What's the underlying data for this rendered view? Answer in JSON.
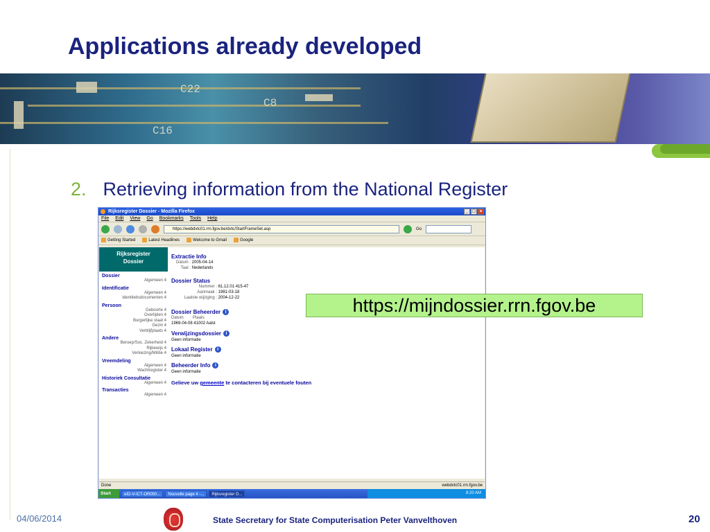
{
  "slide": {
    "title": "Applications already developed",
    "bullet_number": "2.",
    "bullet_text": "Retrieving information from the National Register",
    "url_label": "https://mijndossier.rrn.fgov.be",
    "footer_date": "04/06/2014",
    "footer_text": "State Secretary for State Computerisation Peter Vanvelthoven",
    "page_number": "20",
    "accent_green": "#8dc63f",
    "title_color": "#1a237e"
  },
  "banner": {
    "labels": [
      "C22",
      "C8",
      "C16"
    ]
  },
  "browser": {
    "title": "Rijksregister Dossier - Mozilla Firefox",
    "menu": [
      "File",
      "Edit",
      "View",
      "Go",
      "Bookmarks",
      "Tools",
      "Help"
    ],
    "address": "https://webdvtc01.rrn.fgov.be/dvtc/StartFrameSet.asp",
    "go_label": "Go",
    "bookmarks": [
      "Getting Started",
      "Latest Headlines",
      "Welcome to Gmail",
      "Google"
    ],
    "status": "Done",
    "status_site": "webdvtc01.rrn.fgov.be",
    "taskbar": {
      "start": "Start",
      "tasks": [
        "eID-V-ICT-OR050...",
        "Nouvelle page 4 -...",
        "Rijksregister D..."
      ],
      "clock": "8:20 AM"
    }
  },
  "sidebar": {
    "header_line1": "Rijksregister",
    "header_line2": "Dossier",
    "sections": [
      {
        "title": "Dossier",
        "items": [
          "Algemeen 4"
        ]
      },
      {
        "title": "Identificatie",
        "items": [
          "Algemeen 4",
          "Identiteitsdocumenten 4"
        ]
      },
      {
        "title": "Persoon",
        "items": [
          "Geboorte 4",
          "Overlijden 4",
          "Burgerlijke staat 4",
          "Gezin 4",
          "Verblijfplaats 4"
        ]
      },
      {
        "title": "Andere",
        "items": [
          "Beroep/Soc. Zekerheid 4",
          "Rijbewijs 4",
          "Verkiezing/Militie 4"
        ]
      },
      {
        "title": "Vreemdeling",
        "items": [
          "Algemeen 4",
          "Wachtregister 4"
        ]
      },
      {
        "title": "Historiek Consultatie",
        "items": [
          "Algemeen 4"
        ]
      },
      {
        "title": "Transacties",
        "items": [
          "Algemeen 4"
        ]
      }
    ]
  },
  "main": {
    "extractie": {
      "title": "Extractie Info",
      "datum_label": "Datum :",
      "datum_value": "2005-04-14",
      "taal_label": "Taal :",
      "taal_value": "Nederlands"
    },
    "status": {
      "title": "Dossier Status",
      "nummer_label": "Nummer :",
      "nummer_value": "61.12.01 415-47",
      "aanmaak_label": "Aanmaak :",
      "aanmaak_value": "1981-03-18",
      "wijziging_label": "Laatste wijziging :",
      "wijziging_value": "2004-12-22"
    },
    "beheerder": {
      "title": "Dossier Beheerder",
      "col_datum": "Datum",
      "col_plaats": "Plaats",
      "row": "1969-04-08 41002 Aalst"
    },
    "verwijzing": {
      "title": "Verwijzingsdossier",
      "text": "Geen informatie"
    },
    "lokaal": {
      "title": "Lokaal Register",
      "text": "Geen informatie"
    },
    "beheerder_info": {
      "title": "Beheerder Info",
      "text": "Geen informatie"
    },
    "gelieve_prefix": "Gelieve uw",
    "gelieve_link": "gemeente",
    "gelieve_suffix": "te contacteren bij eventuele fouten"
  }
}
